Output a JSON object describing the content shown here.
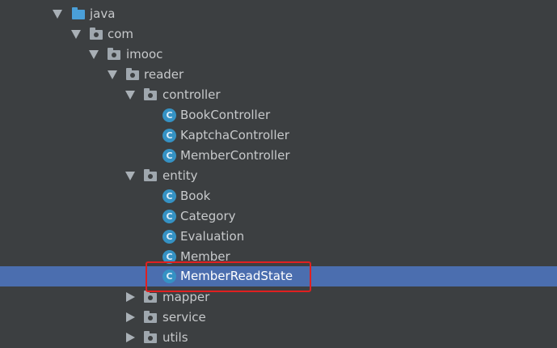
{
  "tree": {
    "java": "java",
    "com": "com",
    "imooc": "imooc",
    "reader": "reader",
    "controller": "controller",
    "book_controller": "BookController",
    "kaptcha_controller": "KaptchaController",
    "member_controller": "MemberController",
    "entity": "entity",
    "book": "Book",
    "category": "Category",
    "evaluation": "Evaluation",
    "member": "Member",
    "member_read_state": "MemberReadState",
    "mapper": "mapper",
    "service": "service",
    "utils": "utils"
  },
  "class_icon_letter": "C",
  "colors": {
    "background": "#3c3f41",
    "selection": "#4b6eaf",
    "class_icon": "#3592c4",
    "source_folder": "#4a9fd8",
    "highlight_box": "#e02020"
  },
  "icons": [
    "chevron-down-icon",
    "chevron-right-icon",
    "folder-icon",
    "package-icon",
    "class-icon"
  ]
}
